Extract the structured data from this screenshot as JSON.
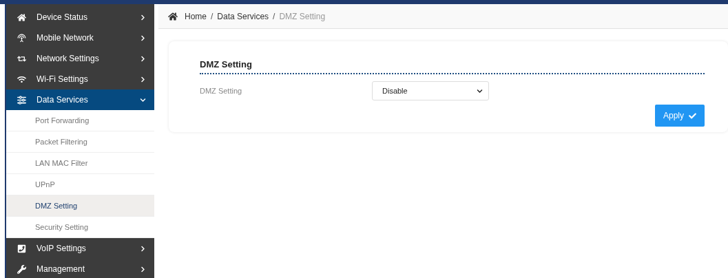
{
  "sidebar": {
    "items": [
      {
        "label": "Device Status",
        "expanded": false
      },
      {
        "label": "Mobile Network",
        "expanded": false
      },
      {
        "label": "Network Settings",
        "expanded": false
      },
      {
        "label": "Wi-Fi Settings",
        "expanded": false
      },
      {
        "label": "Data Services",
        "expanded": true,
        "children": [
          {
            "label": "Port Forwarding",
            "selected": false
          },
          {
            "label": "Packet Filtering",
            "selected": false
          },
          {
            "label": "LAN MAC Filter",
            "selected": false
          },
          {
            "label": "UPnP",
            "selected": false
          },
          {
            "label": "DMZ Setting",
            "selected": true
          },
          {
            "label": "Security Setting",
            "selected": false
          }
        ]
      },
      {
        "label": "VoIP Settings",
        "expanded": false
      },
      {
        "label": "Management",
        "expanded": false
      }
    ]
  },
  "breadcrumb": [
    {
      "kind": "link",
      "text": "Home"
    },
    {
      "kind": "separator",
      "text": "/"
    },
    {
      "kind": "link",
      "text": "Data Services"
    },
    {
      "kind": "separator",
      "text": "/"
    },
    {
      "kind": "current",
      "text": "DMZ Setting"
    }
  ],
  "form": {
    "title": "DMZ Setting",
    "fields": [
      {
        "label": "DMZ Setting",
        "value": "Disable"
      }
    ],
    "button": "Apply"
  }
}
